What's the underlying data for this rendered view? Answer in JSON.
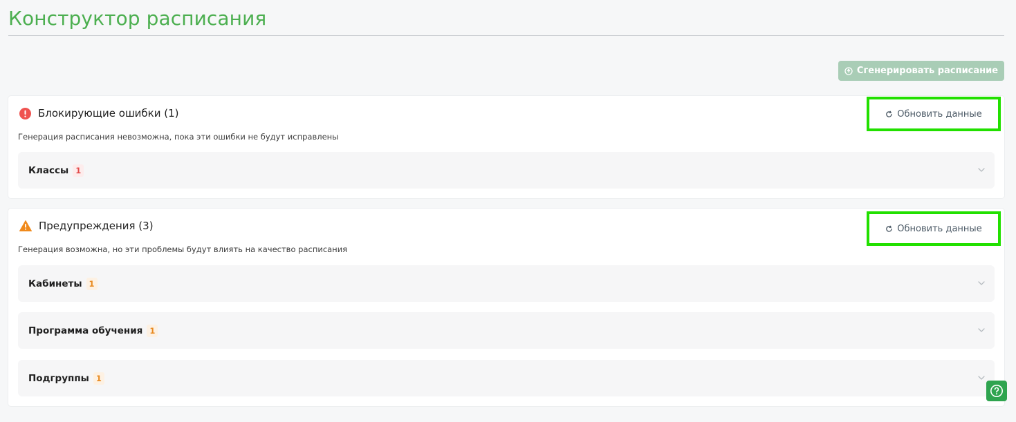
{
  "colors": {
    "brand": "#4caf50",
    "error": "#e24b4b",
    "warning": "#e8891f",
    "highlight": "#22e000"
  },
  "page": {
    "title": "Конструктор расписания"
  },
  "toolbar": {
    "generate_label": "Сгенерировать расписание",
    "generate_icon": "magic-wand-icon"
  },
  "errors": {
    "title": "Блокирующие ошибки (1)",
    "subtitle": "Генерация расписания невозможна, пока эти ошибки не будут исправлены",
    "refresh_label": "Обновить данные",
    "icon": "error-circle-icon",
    "groups": [
      {
        "label": "Классы",
        "count": "1"
      }
    ]
  },
  "warnings": {
    "title": "Предупреждения (3)",
    "subtitle": "Генерация возможна, но эти проблемы будут влиять на качество расписания",
    "refresh_label": "Обновить данные",
    "icon": "warning-triangle-icon",
    "groups": [
      {
        "label": "Кабинеты",
        "count": "1"
      },
      {
        "label": "Программа обучения",
        "count": "1"
      },
      {
        "label": "Подгруппы",
        "count": "1"
      }
    ]
  },
  "help": {
    "icon": "help-circle-icon"
  }
}
